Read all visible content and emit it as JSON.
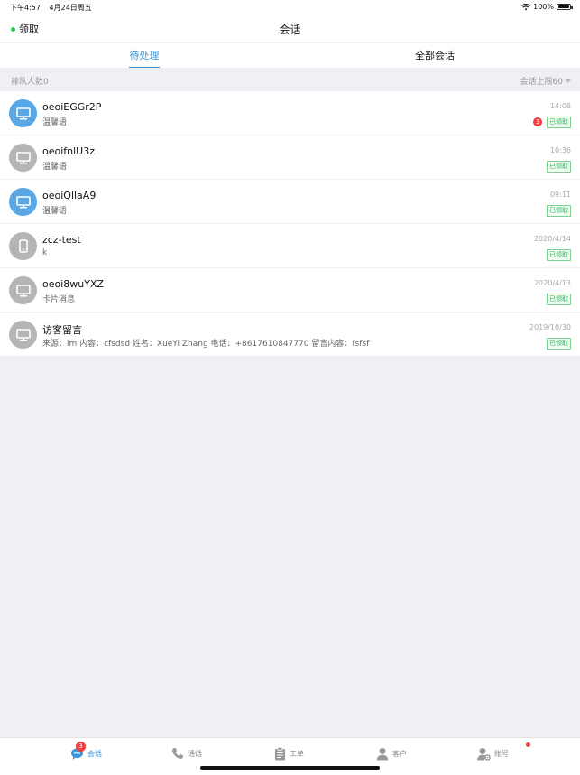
{
  "status_bar": {
    "time": "下午4:57",
    "date": "4月24日周五",
    "battery": "100%",
    "battery_level": 1.0
  },
  "nav": {
    "claim_label": "领取",
    "title": "会话"
  },
  "tabs": {
    "pending": "待处理",
    "all": "全部会话"
  },
  "queue": {
    "count_label": "排队人数0",
    "limit_label": "会话上限60"
  },
  "sessions": [
    {
      "name": "oeoiEGGr2P",
      "sub": "温馨语",
      "time": "14:08",
      "tag": "已领取",
      "unread": "3",
      "icon": "monitor-icon",
      "active": true
    },
    {
      "name": "oeoifnlU3z",
      "sub": "温馨语",
      "time": "10:36",
      "tag": "已领取",
      "icon": "monitor-icon",
      "active": false
    },
    {
      "name": "oeoiQllaA9",
      "sub": "温馨语",
      "time": "09:11",
      "tag": "已领取",
      "icon": "monitor-icon",
      "active": true
    },
    {
      "name": "zcz-test",
      "sub": "k",
      "time": "2020/4/14",
      "tag": "已领取",
      "icon": "phone-device-icon",
      "active": false
    },
    {
      "name": "oeoi8wuYXZ",
      "sub": "卡片消息",
      "time": "2020/4/13",
      "tag": "已领取",
      "icon": "monitor-icon",
      "active": false
    },
    {
      "name": "访客留言",
      "sub": "来源：im 内容：cfsdsd 姓名：XueYi Zhang 电话：+8617610847770 留言内容：fsfsf",
      "time": "2019/10/30",
      "tag": "已领取",
      "icon": "monitor-icon",
      "active": false
    }
  ],
  "tab_bar": {
    "sessions": "会话",
    "sessions_badge": "3",
    "calls": "通话",
    "tickets": "工单",
    "customers": "客户",
    "account": "账号"
  },
  "colors": {
    "accent": "#3a96d8",
    "active_avatar": "#5aa7e6",
    "inactive_avatar": "#b5b5b5",
    "badge": "#f23b3b",
    "tag": "#35b35a"
  }
}
